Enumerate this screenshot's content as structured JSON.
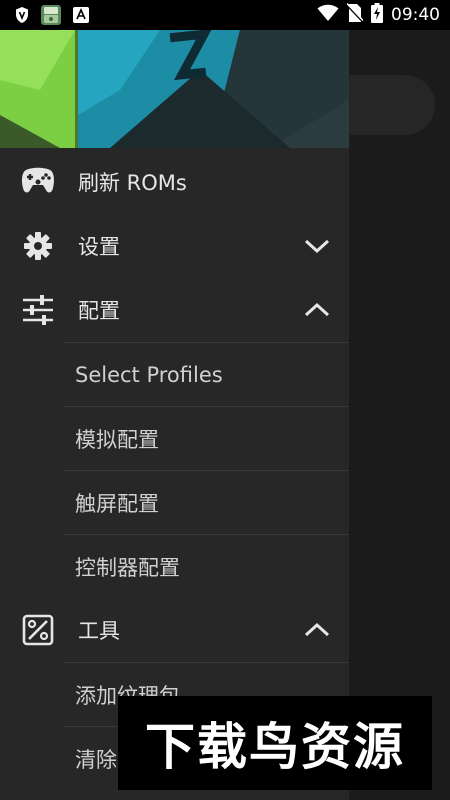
{
  "status_bar": {
    "time": "09:40",
    "notification_icons": [
      "shield-icon",
      "sd-card-icon",
      "app-store-icon"
    ],
    "system_icons": [
      "wifi-icon",
      "no-sim-icon",
      "battery-charging-icon"
    ]
  },
  "drawer": {
    "header": {
      "logo_letter": "Z"
    },
    "items": [
      {
        "label": "刷新 ROMs",
        "icon": "gamepad-icon"
      },
      {
        "label": "设置",
        "icon": "gear-icon",
        "chevron": "chevron-down-icon"
      },
      {
        "label": "配置",
        "icon": "sliders-icon",
        "chevron": "chevron-up-icon",
        "children": [
          "Select Profiles",
          "模拟配置",
          "触屏配置",
          "控制器配置"
        ]
      },
      {
        "label": "工具",
        "icon": "tools-icon",
        "chevron": "chevron-up-icon",
        "children": [
          "添加纹理包",
          "清除"
        ]
      }
    ]
  },
  "watermark": {
    "text": "下载鸟资源"
  },
  "colors": {
    "drawer_bg": "#272727",
    "text": "#e6e6e6",
    "header_green": "#7ed044",
    "header_blue": "#1f8fa8"
  }
}
